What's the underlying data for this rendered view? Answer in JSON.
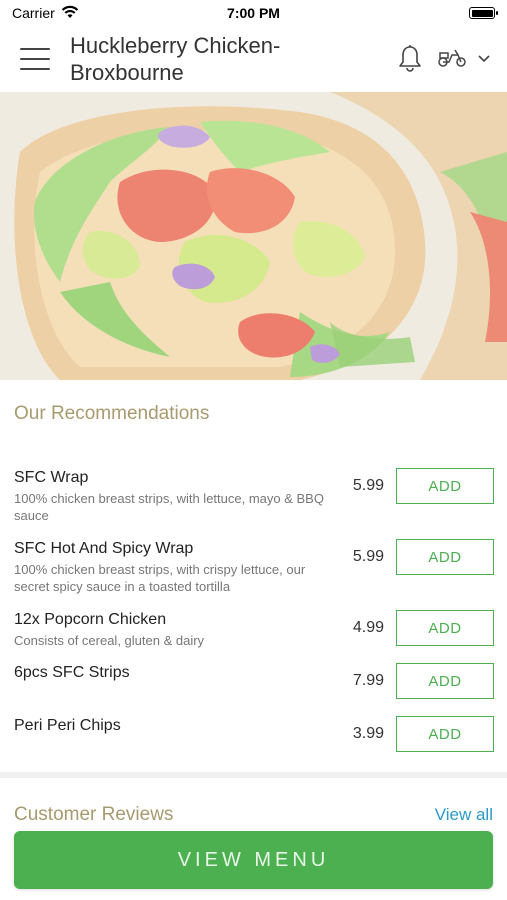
{
  "status": {
    "carrier": "Carrier",
    "time": "7:00 PM"
  },
  "header": {
    "title": "Huckleberry Chicken-Broxbourne",
    "icons": [
      "menu-icon",
      "bell-icon",
      "scooter-icon",
      "chevron-down-icon"
    ]
  },
  "hero": {
    "alt_subject": "wrap-image"
  },
  "recommendations": {
    "title": "Our Recommendations",
    "items": [
      {
        "name": "SFC Wrap",
        "desc": "100% chicken breast strips, with lettuce, mayo & BBQ sauce",
        "price": "5.99",
        "add": "ADD"
      },
      {
        "name": "SFC Hot And Spicy Wrap",
        "desc": "100% chicken breast strips, with crispy lettuce, our secret spicy sauce in a toasted tortilla",
        "price": "5.99",
        "add": "ADD"
      },
      {
        "name": "12x Popcorn Chicken",
        "desc": "Consists of cereal, gluten & dairy",
        "price": "4.99",
        "add": "ADD"
      },
      {
        "name": "6pcs SFC Strips",
        "desc": "",
        "price": "7.99",
        "add": "ADD"
      },
      {
        "name": "Peri Peri Chips",
        "desc": "",
        "price": "3.99",
        "add": "ADD"
      }
    ]
  },
  "reviews": {
    "title": "Customer Reviews",
    "view_all": "View all"
  },
  "cta": {
    "label": "VIEW MENU"
  },
  "colors": {
    "accent_green": "#4caf50",
    "heading_gold": "#a89a6f",
    "link_blue": "#2a9bc9"
  }
}
